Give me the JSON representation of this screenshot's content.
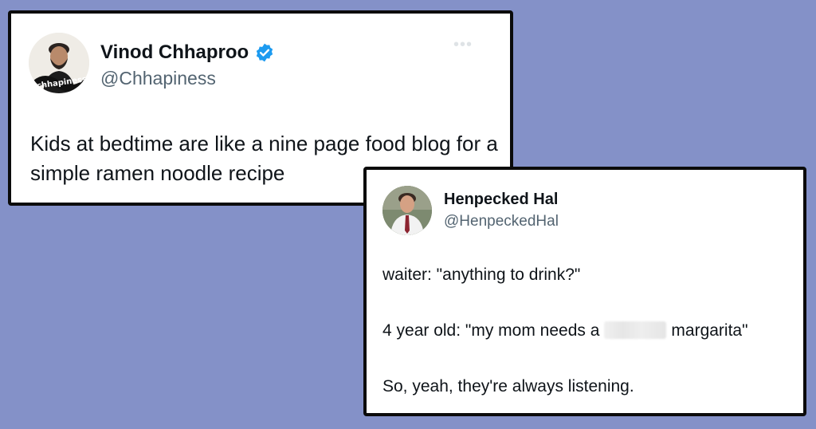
{
  "background_color": "#8491c8",
  "tweets": [
    {
      "name": "Vinod Chhaproo",
      "handle": "@Chhapiness",
      "verified": true,
      "avatar_icon": "profile-photo-man-with-chhapiness-lettering",
      "text": "Kids at bedtime are like a nine page food blog for a simple ramen noodle recipe",
      "more_icon": "ellipsis"
    },
    {
      "name": "Henpecked Hal",
      "handle": "@HenpeckedHal",
      "avatar_icon": "profile-photo-man-in-shirt-and-tie",
      "line1": "waiter: \"anything to drink?\"",
      "line2_before": "4 year old: \"my mom needs a",
      "line2_after": "margarita\"",
      "line3": "So, yeah, they're always listening."
    }
  ],
  "colors": {
    "card_border": "#0b0b0b",
    "name_text": "#0f1419",
    "handle_text": "#536471",
    "verified_badge": "#1d9bf0"
  }
}
